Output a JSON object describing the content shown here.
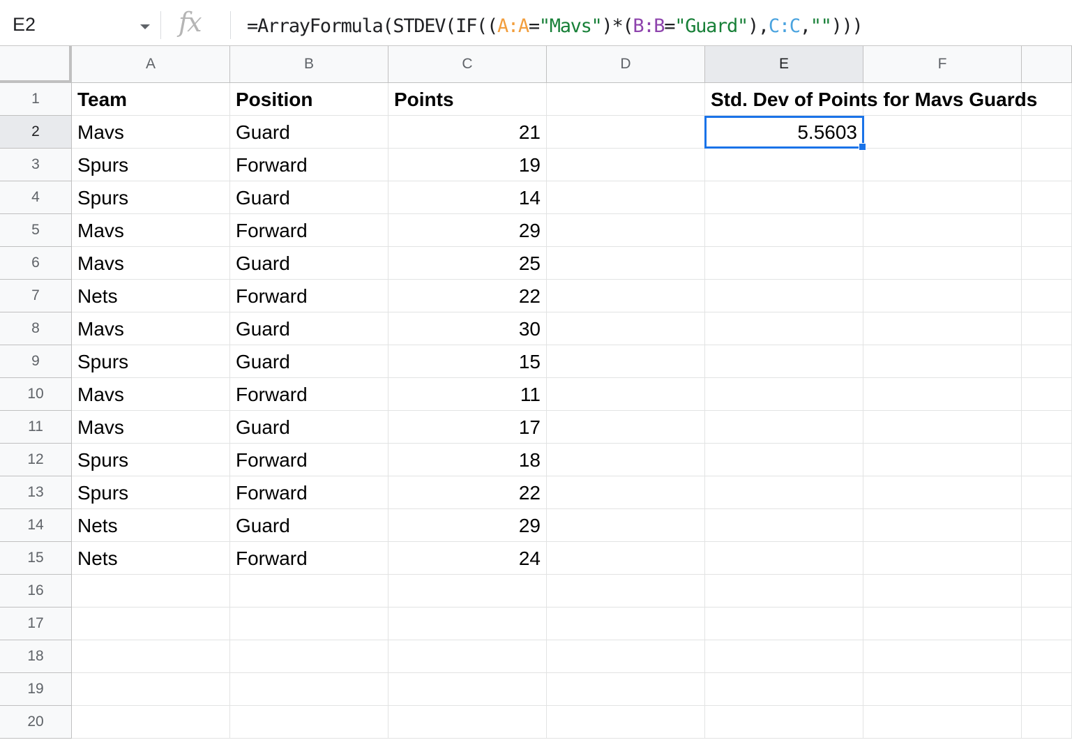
{
  "name_box": "E2",
  "fx_label": "fx",
  "formula_tokens": [
    {
      "t": "=ArrayFormula(STDEV(IF((",
      "c": "#202124"
    },
    {
      "t": "A:A",
      "c": "#f29e3d"
    },
    {
      "t": "=",
      "c": "#202124"
    },
    {
      "t": "\"Mavs\"",
      "c": "#188038"
    },
    {
      "t": ")*(",
      "c": "#202124"
    },
    {
      "t": "B:B",
      "c": "#8e44ad"
    },
    {
      "t": "=",
      "c": "#202124"
    },
    {
      "t": "\"Guard\"",
      "c": "#188038"
    },
    {
      "t": "),",
      "c": "#202124"
    },
    {
      "t": "C:C",
      "c": "#4aa3df"
    },
    {
      "t": ",",
      "c": "#202124"
    },
    {
      "t": "\"\"",
      "c": "#188038"
    },
    {
      "t": ")))",
      "c": "#202124"
    }
  ],
  "columns": [
    "A",
    "B",
    "C",
    "D",
    "E",
    "F"
  ],
  "selected_column": "E",
  "row_count": 20,
  "selected_row": 2,
  "selected_cell": "E2",
  "headers": {
    "team": "Team",
    "position": "Position",
    "points": "Points",
    "result_label": "Std. Dev of Points for Mavs Guards"
  },
  "rows": [
    {
      "team": "Mavs",
      "position": "Guard",
      "points": "21"
    },
    {
      "team": "Spurs",
      "position": "Forward",
      "points": "19"
    },
    {
      "team": "Spurs",
      "position": "Guard",
      "points": "14"
    },
    {
      "team": "Mavs",
      "position": "Forward",
      "points": "29"
    },
    {
      "team": "Mavs",
      "position": "Guard",
      "points": "25"
    },
    {
      "team": "Nets",
      "position": "Forward",
      "points": "22"
    },
    {
      "team": "Mavs",
      "position": "Guard",
      "points": "30"
    },
    {
      "team": "Spurs",
      "position": "Guard",
      "points": "15"
    },
    {
      "team": "Mavs",
      "position": "Forward",
      "points": "11"
    },
    {
      "team": "Mavs",
      "position": "Guard",
      "points": "17"
    },
    {
      "team": "Spurs",
      "position": "Forward",
      "points": "18"
    },
    {
      "team": "Spurs",
      "position": "Forward",
      "points": "22"
    },
    {
      "team": "Nets",
      "position": "Guard",
      "points": "29"
    },
    {
      "team": "Nets",
      "position": "Forward",
      "points": "24"
    }
  ],
  "result_value": "5.5603"
}
